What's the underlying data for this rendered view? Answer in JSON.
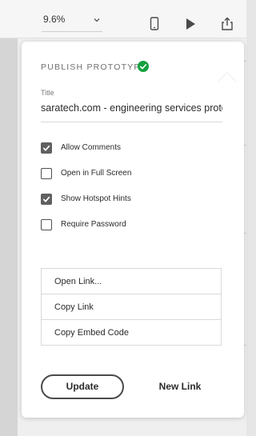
{
  "toolbar": {
    "zoom_value": "9.6%",
    "icons": [
      "mobile-device-icon",
      "play-icon",
      "share-icon"
    ]
  },
  "popup": {
    "heading": "PUBLISH PROTOTYPE",
    "title_label": "Title",
    "title_value": "saratech.com - engineering services protot",
    "options": [
      {
        "label": "Allow Comments",
        "checked": true
      },
      {
        "label": "Open in Full Screen",
        "checked": false
      },
      {
        "label": "Show Hotspot Hints",
        "checked": true
      },
      {
        "label": "Require Password",
        "checked": false
      }
    ],
    "actions": [
      "Open Link...",
      "Copy Link",
      "Copy Embed Code"
    ],
    "update_label": "Update",
    "new_link_label": "New Link"
  },
  "colors": {
    "success_green": "#12a03e",
    "checkbox_checked": "#606060"
  }
}
